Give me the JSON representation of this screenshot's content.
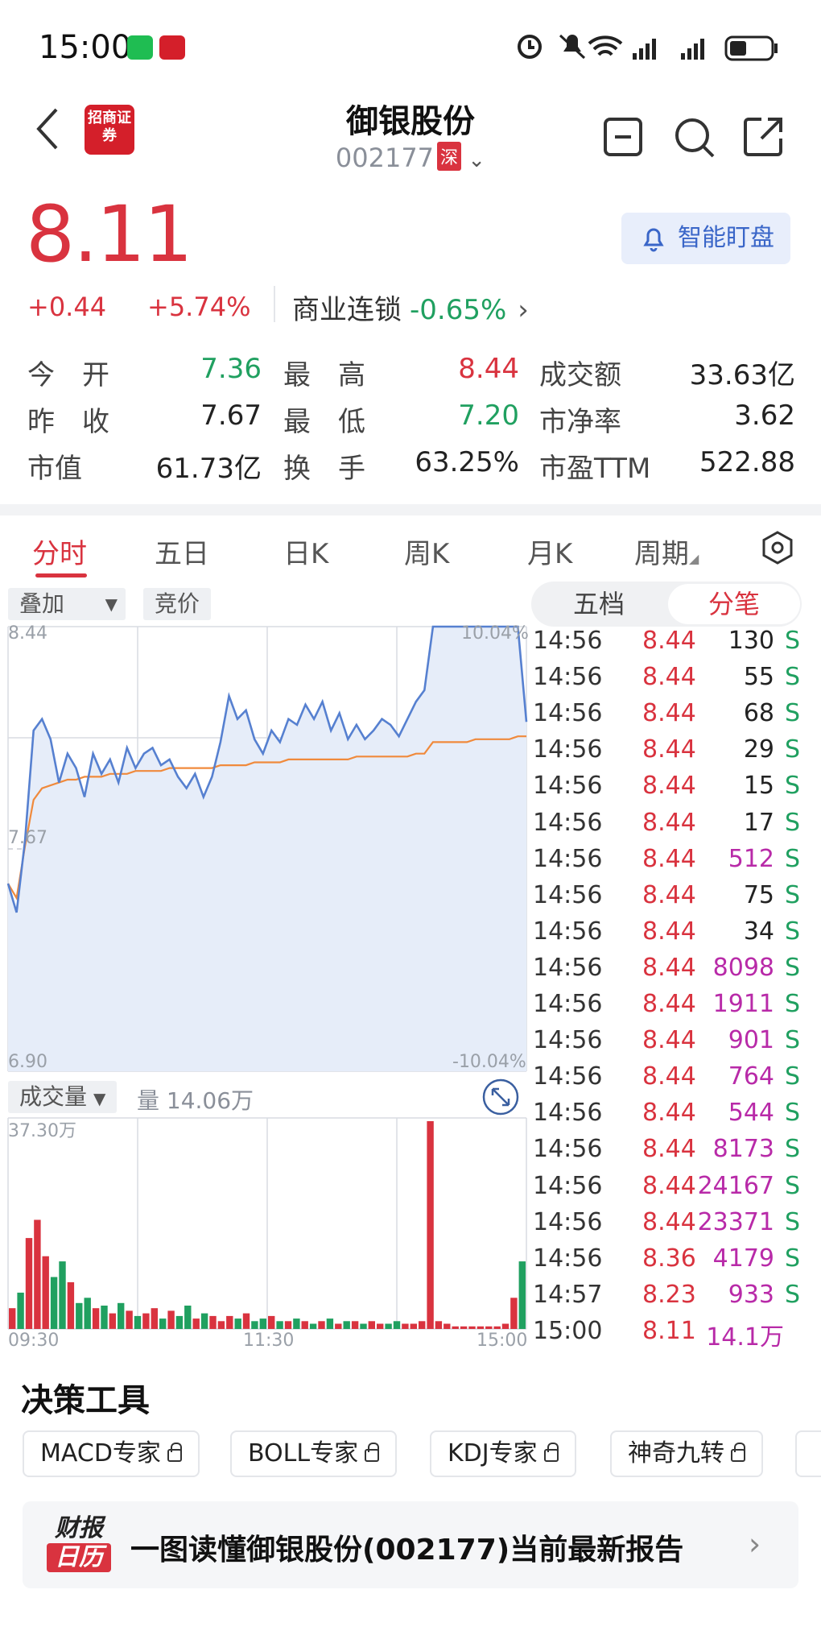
{
  "status": {
    "time": "15:00"
  },
  "header": {
    "name": "御银股份",
    "code": "002177",
    "market": "深",
    "logo_text": "招商证券"
  },
  "quote": {
    "price": "8.11",
    "change": "+0.44",
    "change_pct": "+5.74%",
    "sector": "商业连锁",
    "sector_pct": "-0.65%",
    "alert_label": "智能盯盘"
  },
  "stats": [
    {
      "label": "今　开",
      "value": "7.36",
      "color": "green"
    },
    {
      "label": "最　高",
      "value": "8.44",
      "color": "red"
    },
    {
      "label": "成交额",
      "value": "33.63亿",
      "color": "dark"
    },
    {
      "label": "昨　收",
      "value": "7.67",
      "color": "dark"
    },
    {
      "label": "最　低",
      "value": "7.20",
      "color": "green"
    },
    {
      "label": "市净率",
      "value": "3.62",
      "color": "dark"
    },
    {
      "label": "市值",
      "value": "61.73亿",
      "color": "dark"
    },
    {
      "label": "换　手",
      "value": "63.25%",
      "color": "dark"
    },
    {
      "label": "市盈TTM",
      "value": "522.88",
      "color": "dark"
    }
  ],
  "tabs": [
    "分时",
    "五日",
    "日K",
    "周K",
    "月K",
    "周期"
  ],
  "chart_controls": {
    "overlay": "叠加",
    "auction": "竞价",
    "five_level": "五档",
    "ticks": "分笔",
    "volume_label": "成交量",
    "volume_qty": "量 14.06万"
  },
  "chart_axes": {
    "price_max": "8.44",
    "price_mid": "7.67",
    "price_min": "6.90",
    "pct_max": "10.04%",
    "pct_min": "-10.04%",
    "vol_max": "37.30万",
    "time_start": "09:30",
    "time_mid": "11:30",
    "time_end": "15:00"
  },
  "chart_data": {
    "type": "line",
    "ylim": [
      6.9,
      8.44
    ],
    "series": [
      {
        "values": [
          7.55,
          7.45,
          7.7,
          8.08,
          8.12,
          8.05,
          7.9,
          8.0,
          7.95,
          7.85,
          8.0,
          7.93,
          7.98,
          7.9,
          8.02,
          7.95,
          8.0,
          8.02,
          7.96,
          7.98,
          7.92,
          7.88,
          7.93,
          7.85,
          7.92,
          8.04,
          8.2,
          8.12,
          8.15,
          8.05,
          8.0,
          8.08,
          8.04,
          8.12,
          8.1,
          8.17,
          8.12,
          8.18,
          8.08,
          8.14,
          8.05,
          8.1,
          8.05,
          8.08,
          8.12,
          8.1,
          8.06,
          8.12,
          8.18,
          8.22,
          8.44,
          8.44,
          8.44,
          8.44,
          8.44,
          8.44,
          8.44,
          8.44,
          8.44,
          8.44,
          8.44,
          8.11
        ]
      },
      {
        "values": [
          7.55,
          7.5,
          7.68,
          7.84,
          7.88,
          7.89,
          7.9,
          7.91,
          7.91,
          7.92,
          7.92,
          7.92,
          7.93,
          7.93,
          7.93,
          7.94,
          7.94,
          7.94,
          7.94,
          7.95,
          7.95,
          7.95,
          7.95,
          7.95,
          7.95,
          7.96,
          7.96,
          7.96,
          7.96,
          7.97,
          7.97,
          7.97,
          7.97,
          7.98,
          7.98,
          7.98,
          7.98,
          7.98,
          7.98,
          7.98,
          7.98,
          7.99,
          7.99,
          7.99,
          7.99,
          7.99,
          7.99,
          7.99,
          8.0,
          8.0,
          8.04,
          8.04,
          8.04,
          8.04,
          8.04,
          8.05,
          8.05,
          8.05,
          8.05,
          8.05,
          8.06,
          8.06
        ]
      }
    ]
  },
  "volume_data": [
    8,
    14,
    35,
    42,
    28,
    20,
    26,
    18,
    10,
    12,
    8,
    9,
    6,
    10,
    7,
    5,
    6,
    8,
    4,
    7,
    5,
    9,
    4,
    6,
    5,
    3,
    5,
    4,
    6,
    3,
    4,
    5,
    3,
    3,
    4,
    3,
    2,
    3,
    4,
    2,
    3,
    3,
    2,
    3,
    2,
    2,
    3,
    2,
    2,
    3,
    80,
    3,
    2,
    1,
    1,
    1,
    1,
    1,
    1,
    2,
    12,
    26
  ],
  "ticks": [
    {
      "time": "14:56",
      "price": "8.44",
      "vol": "130",
      "side": "S",
      "big": false
    },
    {
      "time": "14:56",
      "price": "8.44",
      "vol": "55",
      "side": "S",
      "big": false
    },
    {
      "time": "14:56",
      "price": "8.44",
      "vol": "68",
      "side": "S",
      "big": false
    },
    {
      "time": "14:56",
      "price": "8.44",
      "vol": "29",
      "side": "S",
      "big": false
    },
    {
      "time": "14:56",
      "price": "8.44",
      "vol": "15",
      "side": "S",
      "big": false
    },
    {
      "time": "14:56",
      "price": "8.44",
      "vol": "17",
      "side": "S",
      "big": false
    },
    {
      "time": "14:56",
      "price": "8.44",
      "vol": "512",
      "side": "S",
      "big": true
    },
    {
      "time": "14:56",
      "price": "8.44",
      "vol": "75",
      "side": "S",
      "big": false
    },
    {
      "time": "14:56",
      "price": "8.44",
      "vol": "34",
      "side": "S",
      "big": false
    },
    {
      "time": "14:56",
      "price": "8.44",
      "vol": "8098",
      "side": "S",
      "big": true
    },
    {
      "time": "14:56",
      "price": "8.44",
      "vol": "1911",
      "side": "S",
      "big": true
    },
    {
      "time": "14:56",
      "price": "8.44",
      "vol": "901",
      "side": "S",
      "big": true
    },
    {
      "time": "14:56",
      "price": "8.44",
      "vol": "764",
      "side": "S",
      "big": true
    },
    {
      "time": "14:56",
      "price": "8.44",
      "vol": "544",
      "side": "S",
      "big": true
    },
    {
      "time": "14:56",
      "price": "8.44",
      "vol": "8173",
      "side": "S",
      "big": true
    },
    {
      "time": "14:56",
      "price": "8.44",
      "vol": "24167",
      "side": "S",
      "big": true
    },
    {
      "time": "14:56",
      "price": "8.44",
      "vol": "23371",
      "side": "S",
      "big": true
    },
    {
      "time": "14:56",
      "price": "8.36",
      "vol": "4179",
      "side": "S",
      "big": true
    },
    {
      "time": "14:57",
      "price": "8.23",
      "vol": "933",
      "side": "S",
      "big": true
    },
    {
      "time": "15:00",
      "price": "8.11",
      "vol": "14.1万",
      "side": "",
      "big": true
    }
  ],
  "tools": {
    "title": "决策工具",
    "items": [
      "MACD专家",
      "BOLL专家",
      "KDJ专家",
      "神奇九转"
    ]
  },
  "report": {
    "badge_top": "财报",
    "badge_bottom": "日历",
    "text": "一图读懂御银股份(002177)当前最新报告"
  }
}
